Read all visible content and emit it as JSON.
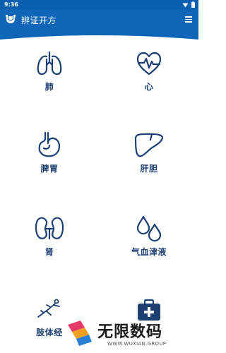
{
  "status_bar": {
    "time": "9:36",
    "icons": [
      "wifi-icon",
      "battery-icon"
    ]
  },
  "app_bar": {
    "title": "辨证开方",
    "logo_icon": "app-logo-icon",
    "menu_icon": "menu-icon"
  },
  "categories": [
    {
      "label": "肺",
      "icon": "lungs-icon"
    },
    {
      "label": "心",
      "icon": "heart-pulse-icon"
    },
    {
      "label": "脾胃",
      "icon": "stomach-icon"
    },
    {
      "label": "肝胆",
      "icon": "liver-icon"
    },
    {
      "label": "肾",
      "icon": "kidney-icon"
    },
    {
      "label": "气血津液",
      "icon": "drops-icon"
    },
    {
      "label": "肢体经",
      "icon": "body-figure-icon"
    },
    {
      "label": "",
      "icon": "medical-kit-icon"
    }
  ],
  "watermark": {
    "title": "无限数码",
    "subtitle": "WWW.WUXIAN.GROUP"
  },
  "colors": {
    "primary": "#0f66b8",
    "status_bar": "#0c5fb0",
    "icon_navy": "#1d3f72",
    "background": "#ffffff"
  }
}
